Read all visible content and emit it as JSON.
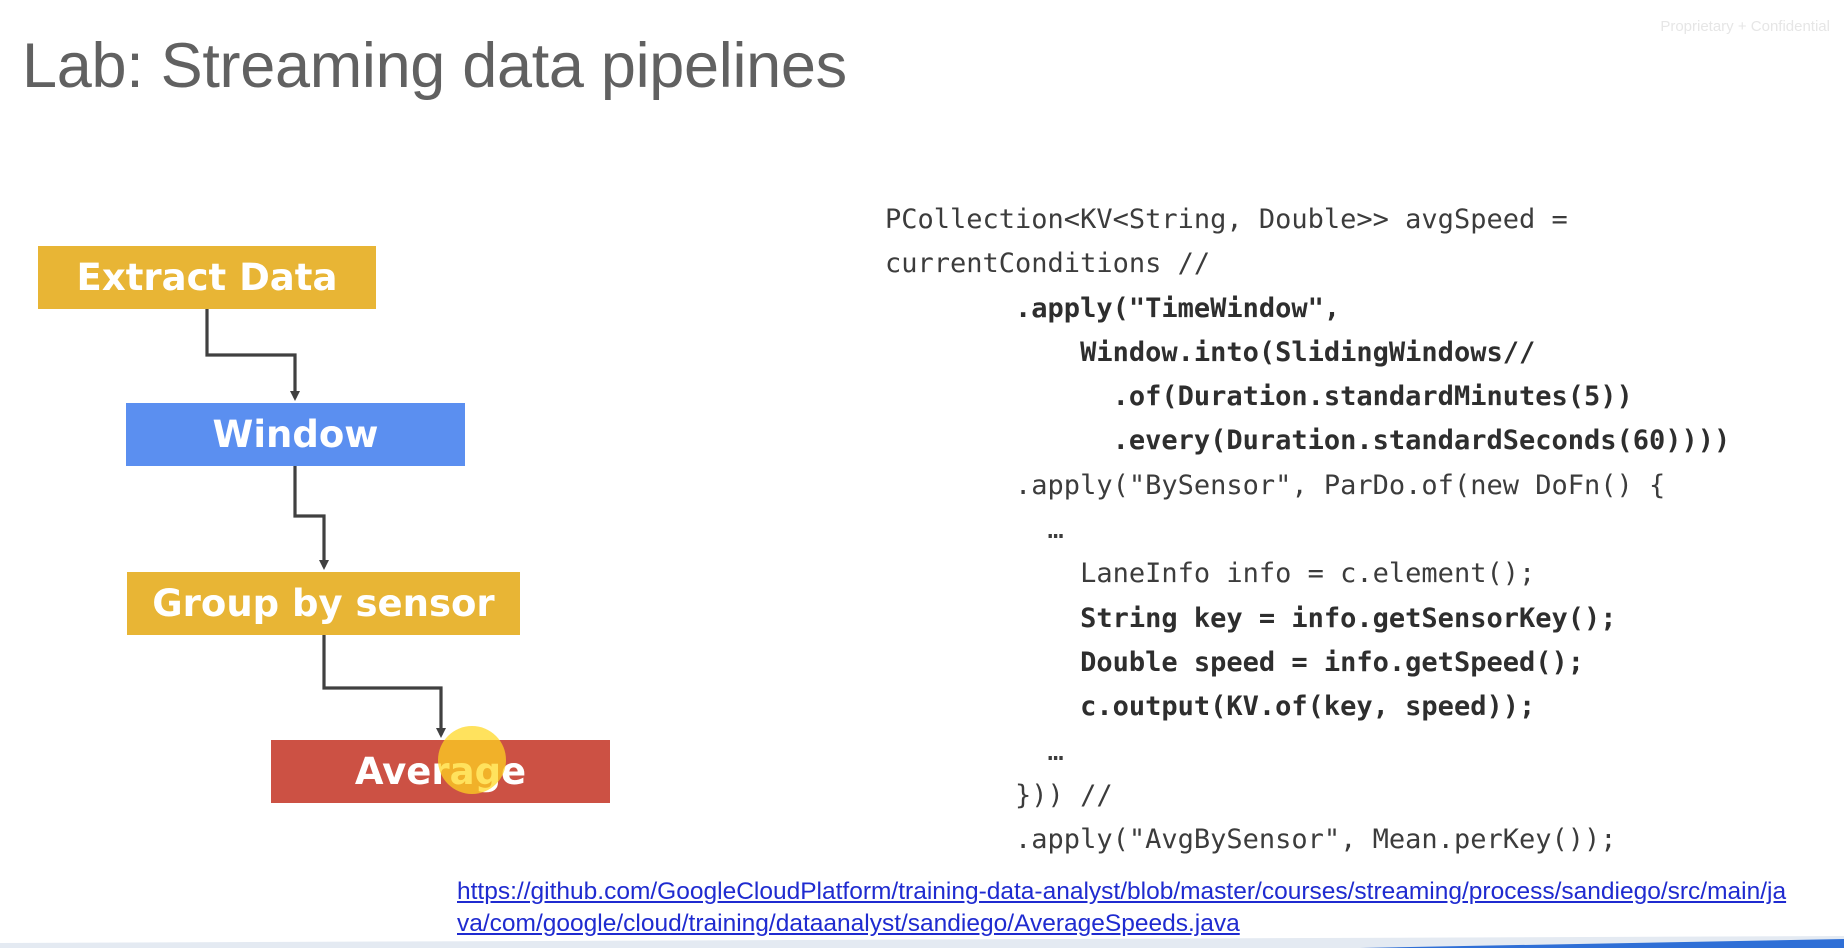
{
  "header": {
    "title": "Lab: Streaming data pipelines",
    "confidential_label": "Proprietary + Confidential"
  },
  "pipeline": {
    "steps": [
      {
        "label": "Extract Data",
        "color": "#e8b535"
      },
      {
        "label": "Window",
        "color": "#5b8ff0"
      },
      {
        "label": "Group by sensor",
        "color": "#e8b535"
      },
      {
        "label": "Average",
        "color": "#cc5144"
      }
    ],
    "arrow_color": "#404040"
  },
  "code": {
    "lines": [
      {
        "text": "PCollection<KV<String, Double>> avgSpeed =",
        "bold": false
      },
      {
        "text": "currentConditions //",
        "bold": false
      },
      {
        "text": "        .apply(\"TimeWindow\",",
        "bold": true
      },
      {
        "text": "            Window.into(SlidingWindows//",
        "bold": true
      },
      {
        "text": "              .of(Duration.standardMinutes(5))",
        "bold": true
      },
      {
        "text": "              .every(Duration.standardSeconds(60))))",
        "bold": true
      },
      {
        "text": "        .apply(\"BySensor\", ParDo.of(new DoFn() {",
        "bold": false
      },
      {
        "text": "          …",
        "bold": false
      },
      {
        "text": "            LaneInfo info = c.element();",
        "bold": false
      },
      {
        "text": "            String key = info.getSensorKey();",
        "bold": true
      },
      {
        "text": "            Double speed = info.getSpeed();",
        "bold": true
      },
      {
        "text": "            c.output(KV.of(key, speed));",
        "bold": true
      },
      {
        "text": "          …",
        "bold": false
      },
      {
        "text": "        })) //",
        "bold": false
      },
      {
        "text": "        .apply(\"AvgBySensor\", Mean.perKey());",
        "bold": false
      }
    ]
  },
  "source_link": {
    "text": "https://github.com/GoogleCloudPlatform/training-data-analyst/blob/master/courses/streaming/process/sandiego/src/main/java/com/google/cloud/training/dataanalyst/sandiego/AverageSpeeds.java"
  },
  "colors": {
    "title": "#616161",
    "link": "#1f2bd0",
    "bottom_band": "#2f6fd6"
  }
}
